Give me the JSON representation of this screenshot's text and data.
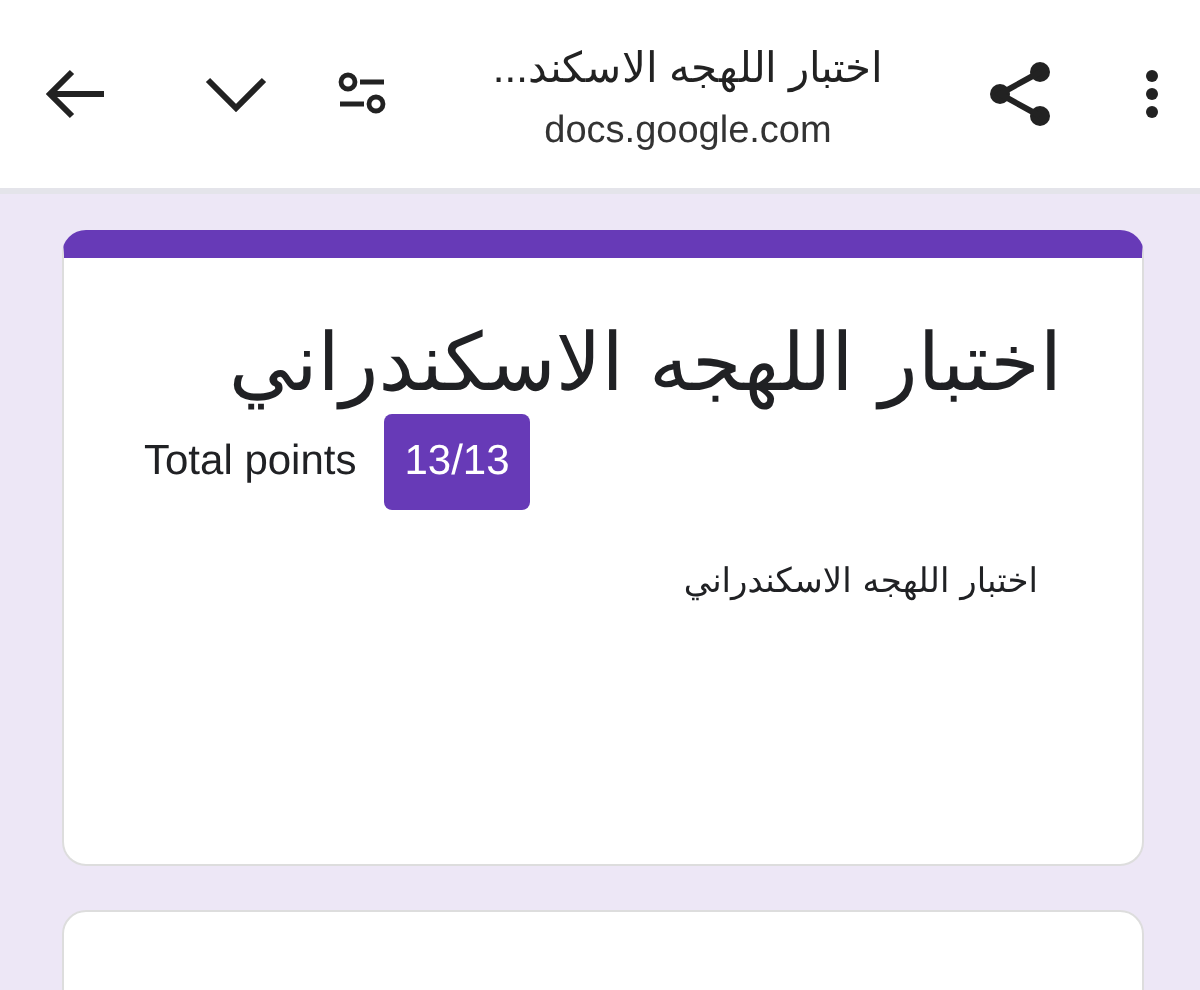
{
  "browser_bar": {
    "title": "اختبار اللهجه الاسكند...",
    "url": "docs.google.com"
  },
  "form_card": {
    "title": "اختبار اللهجه الاسكندراني",
    "score_label": "Total points",
    "score": "13/13",
    "description": "اختبار اللهجه الاسكندراني"
  }
}
